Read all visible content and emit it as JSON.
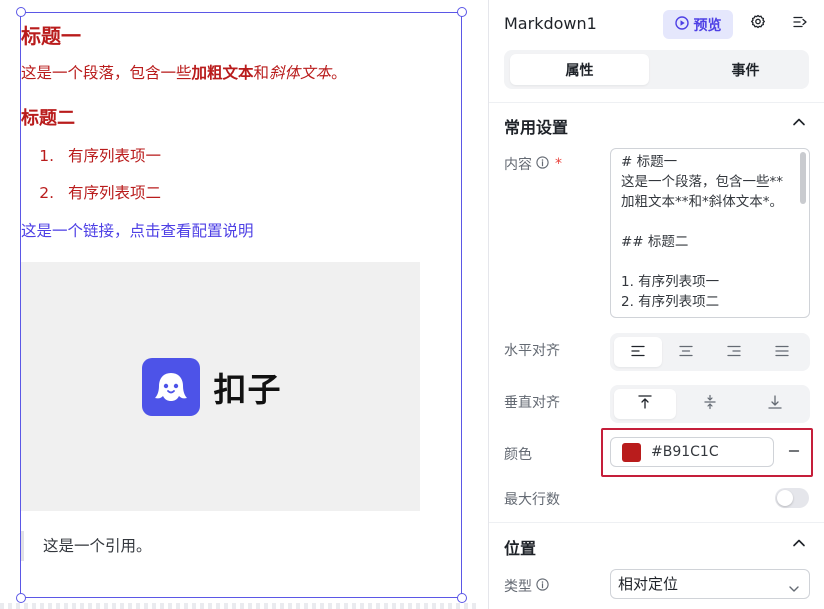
{
  "canvas": {
    "markdown": {
      "heading1": "标题一",
      "paragraph": {
        "part1": "这是一个段落，包含一些",
        "bold": "加粗文本",
        "part2": "和",
        "italic": "斜体文本",
        "part3": "。"
      },
      "heading2": "标题二",
      "ordered_list": [
        {
          "num": "1.",
          "text": "有序列表项一"
        },
        {
          "num": "2.",
          "text": "有序列表项二"
        }
      ],
      "link": "这是一个链接，点击查看配置说明",
      "image_logo_text": "扣子",
      "quote": "这是一个引用。"
    },
    "text_color": "#B91C1C",
    "selection_color": "#5B57E6"
  },
  "panel": {
    "component_name": "Markdown1",
    "preview_label": "预览",
    "tabs": [
      {
        "label": "属性",
        "active": true
      },
      {
        "label": "事件",
        "active": false
      }
    ],
    "common_section": {
      "title": "常用设置",
      "content": {
        "label": "内容",
        "value": "# 标题一\n这是一个段落，包含一些**加粗文本**和*斜体文本*。\n\n## 标题二\n\n1. 有序列表项一\n2. 有序列表项二"
      },
      "horizontal_align": {
        "label": "水平对齐",
        "options": [
          "align-left",
          "align-center",
          "align-right",
          "align-justify"
        ],
        "selected": 0
      },
      "vertical_align": {
        "label": "垂直对齐",
        "options": [
          "align-top",
          "align-middle",
          "align-bottom"
        ],
        "selected": 0
      },
      "color": {
        "label": "颜色",
        "value": "#B91C1C"
      },
      "max_lines": {
        "label": "最大行数",
        "enabled": false
      }
    },
    "position_section": {
      "title": "位置",
      "type": {
        "label": "类型",
        "value": "相对定位"
      }
    }
  }
}
